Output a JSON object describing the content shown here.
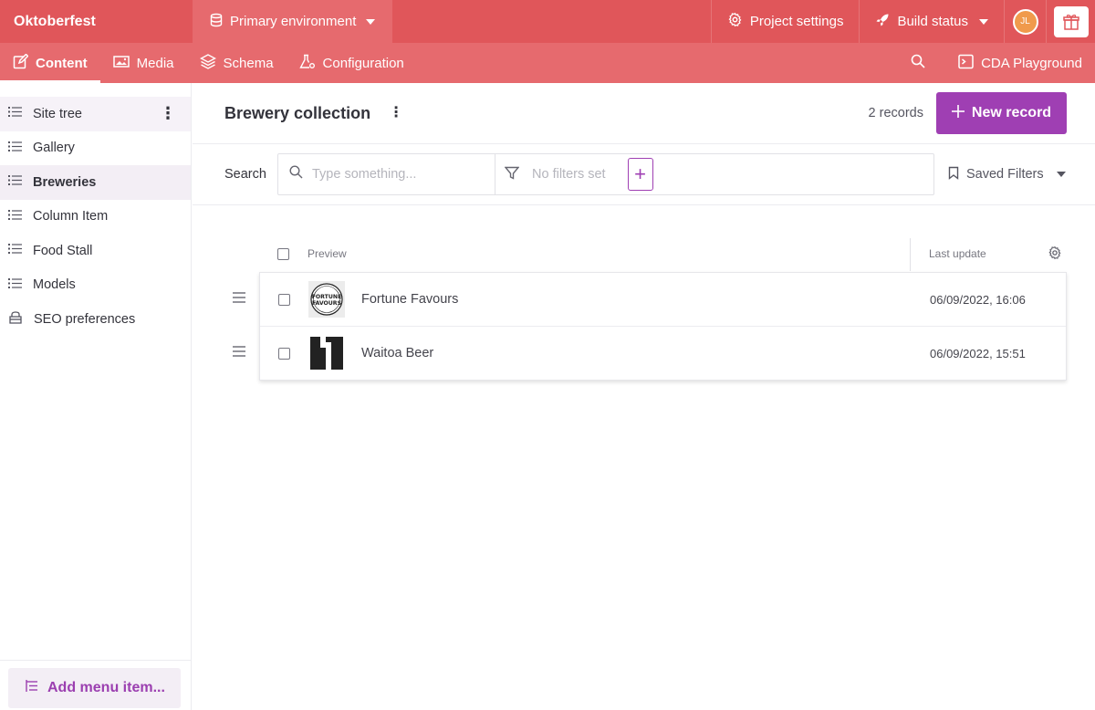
{
  "topbar": {
    "project_name": "Oktoberfest",
    "environment_label": "Primary environment",
    "project_settings_label": "Project settings",
    "build_status_label": "Build status",
    "avatar_initials": "JL",
    "accent_color": "#e0565a"
  },
  "navbar": {
    "tabs": [
      {
        "label": "Content",
        "icon": "edit-icon"
      },
      {
        "label": "Media",
        "icon": "image-icon"
      },
      {
        "label": "Schema",
        "icon": "layers-icon"
      },
      {
        "label": "Configuration",
        "icon": "flask-icon"
      }
    ],
    "cda_playground_label": "CDA Playground"
  },
  "sidebar": {
    "items": [
      {
        "label": "Site tree",
        "icon": "list-icon"
      },
      {
        "label": "Gallery",
        "icon": "list-icon"
      },
      {
        "label": "Breweries",
        "icon": "list-icon"
      },
      {
        "label": "Column Item",
        "icon": "list-icon"
      },
      {
        "label": "Food Stall",
        "icon": "list-icon"
      },
      {
        "label": "Models",
        "icon": "list-icon"
      },
      {
        "label": "SEO preferences",
        "icon": "seo-icon"
      }
    ],
    "add_menu_item_label": "Add menu item..."
  },
  "main": {
    "collection_title": "Brewery collection",
    "record_count": "2 records",
    "new_record_label": "New record",
    "search_label": "Search",
    "search_placeholder": "Type something...",
    "filters_placeholder": "No filters set",
    "saved_filters_label": "Saved Filters",
    "primary_color": "#9f3fb3"
  },
  "table": {
    "columns": [
      "Preview",
      "Last update"
    ],
    "rows": [
      {
        "title": "Fortune Favours",
        "last_update": "06/09/2022, 16:06",
        "thumb_text": "FORTUNE FAVOURS"
      },
      {
        "title": "Waitoa Beer",
        "last_update": "06/09/2022, 15:51"
      }
    ]
  }
}
